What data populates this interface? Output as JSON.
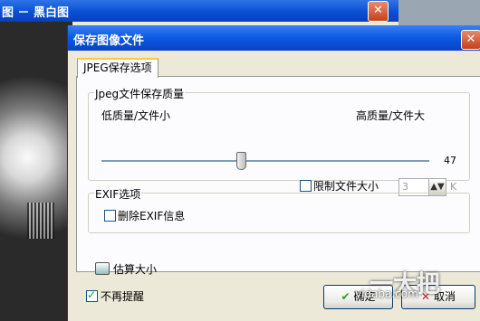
{
  "background_window": {
    "title": "图 － 黑白图",
    "close": "✕"
  },
  "dialog": {
    "title": "保存图像文件",
    "close": "✕",
    "tab": "JPEG保存选项",
    "quality_group": {
      "title": "Jpeg文件保存质量",
      "low_label": "低质量/文件小",
      "high_label": "高质量/文件大",
      "value": "47",
      "value_fraction": 0.41
    },
    "limit_size": {
      "label": "限制文件大小",
      "checked": false,
      "value": "3",
      "unit": "K"
    },
    "exif_group": {
      "title": "EXIF选项",
      "remove_label": "删除EXIF信息",
      "checked": false
    },
    "estimate_label": "估算大小",
    "no_remind": {
      "label": "不再提醒",
      "checked": true
    },
    "ok_label": "确定",
    "cancel_label": "取消"
  },
  "watermark": {
    "text": "一大把",
    "site": "yidaba.com"
  }
}
